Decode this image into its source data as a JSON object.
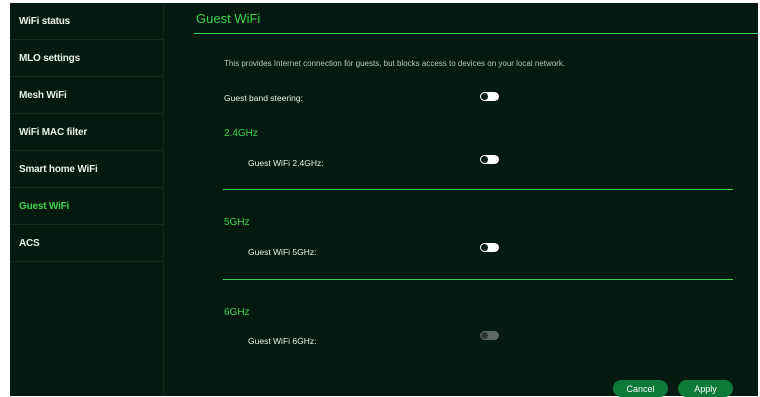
{
  "sidebar": {
    "items": [
      {
        "label": "WiFi status"
      },
      {
        "label": "MLO settings"
      },
      {
        "label": "Mesh WiFi"
      },
      {
        "label": "WiFi MAC filter"
      },
      {
        "label": "Smart home WiFi"
      },
      {
        "label": "Guest WiFi",
        "active": true
      },
      {
        "label": "ACS"
      }
    ]
  },
  "main": {
    "title": "Guest WiFi",
    "description": "This provides Internet connection for guests, but blocks access to devices on your local network.",
    "guest_band_steering": {
      "label": "Guest band steering:",
      "state": "off"
    },
    "bands": [
      {
        "title": "2.4GHz",
        "label": "Guest WiFi 2.4GHz:",
        "state": "off"
      },
      {
        "title": "5GHz",
        "label": "Guest WiFi 5GHz:",
        "state": "off"
      },
      {
        "title": "6GHz",
        "label": "Guest WiFi 6GHz:",
        "state": "off-disabled"
      }
    ]
  },
  "actions": {
    "cancel_label": "Cancel",
    "apply_label": "Apply"
  },
  "colors": {
    "background": "#041a10",
    "accent": "#3fd34a",
    "button": "#0e7a3a"
  }
}
